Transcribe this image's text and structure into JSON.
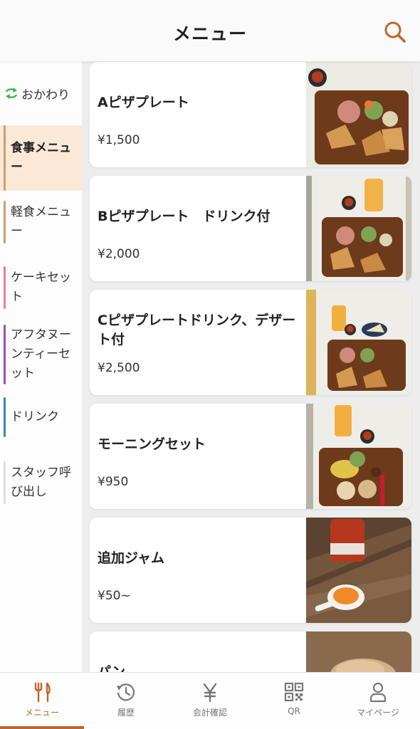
{
  "header": {
    "title": "メニュー"
  },
  "sidebar": {
    "refill_label": "おかわり",
    "categories": [
      {
        "label": "食事メニュー",
        "color": "#c8a06e",
        "active": true
      },
      {
        "label": "軽食メニュー",
        "color": "#c8a06e"
      },
      {
        "label": "ケーキセット",
        "color": "#e97aa5"
      },
      {
        "label": "アフタヌーンティーセット",
        "color": "#9656b0"
      },
      {
        "label": "ドリンク",
        "color": "#3f7fb8"
      },
      {
        "label": "スタッフ呼び出し",
        "color": "#dddddd"
      }
    ]
  },
  "menu": {
    "items": [
      {
        "name": "Aピザプレート",
        "price": "¥1,500"
      },
      {
        "name": "Bピザプレート　ドリンク付",
        "price": "¥2,000"
      },
      {
        "name": "Cピザプレートドリンク、デザート付",
        "price": "¥2,500"
      },
      {
        "name": "モーニングセット",
        "price": "¥950"
      },
      {
        "name": "追加ジャム",
        "price": "¥50~"
      },
      {
        "name": "パン",
        "price": ""
      }
    ]
  },
  "tabbar": {
    "tabs": [
      {
        "label": "メニュー",
        "icon": "fork-knife-icon",
        "active": true
      },
      {
        "label": "履歴",
        "icon": "history-icon"
      },
      {
        "label": "会計確認",
        "icon": "yen-icon"
      },
      {
        "label": "QR",
        "icon": "qr-code-icon"
      },
      {
        "label": "マイページ",
        "icon": "person-icon"
      }
    ]
  },
  "colors": {
    "accent": "#c0652c",
    "refill": "#3fb54a",
    "active_category_bg": "#fbe8d6"
  }
}
